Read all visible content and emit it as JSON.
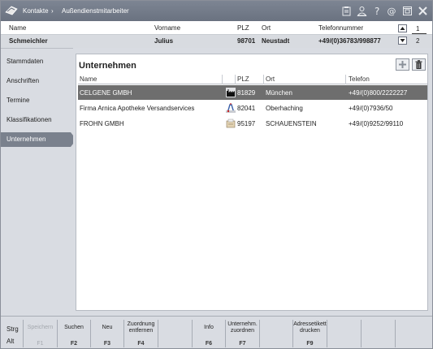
{
  "titlebar": {
    "crumb_root": "Kontakte",
    "separator": "›",
    "crumb_current": "Außendienstmitarbeiter"
  },
  "header": {
    "columns": [
      "Name",
      "Vorname",
      "PLZ",
      "Ort",
      "Telefonnummer"
    ],
    "record": {
      "name": "Schmeichler",
      "vorname": "Julius",
      "plz": "98701",
      "ort": "Neustadt",
      "telefon": "+49/(0)36783/998877"
    },
    "page_current": "1",
    "page_total": "2"
  },
  "nav": {
    "items": [
      {
        "label": "Stammdaten",
        "active": false
      },
      {
        "label": "Anschriften",
        "active": false
      },
      {
        "label": "Termine",
        "active": false
      },
      {
        "label": "Klassifikationen",
        "active": false
      },
      {
        "label": "Unternehmen",
        "active": true
      }
    ]
  },
  "panel": {
    "title": "Unternehmen",
    "columns": [
      "Name",
      "PLZ",
      "Ort",
      "Telefon"
    ],
    "rows": [
      {
        "name": "CELGENE GMBH",
        "icon": "factory-icon",
        "plz": "81829",
        "ort": "München",
        "telefon": "+49/(0)800/2222227",
        "selected": true
      },
      {
        "name": "Firma Arnica Apotheke Versandservices",
        "icon": "pharmacy-icon",
        "plz": "82041",
        "ort": "Oberhaching",
        "telefon": "+49/(0)7936/50",
        "selected": false
      },
      {
        "name": "FROHN GMBH",
        "icon": "wholesaler-icon",
        "plz": "95197",
        "ort": "SCHAUENSTEIN",
        "telefon": "+49/(0)9252/99110",
        "selected": false
      }
    ]
  },
  "fkeys": {
    "mod_strg": "Strg",
    "mod_alt": "Alt",
    "keys": [
      {
        "label": "Speichern",
        "code": "F1",
        "disabled": true
      },
      {
        "label": "Suchen",
        "code": "F2",
        "disabled": false
      },
      {
        "label": "Neu",
        "code": "F3",
        "disabled": false
      },
      {
        "label": "Zuordnung entfernen",
        "code": "F4",
        "disabled": false
      },
      {
        "label": "",
        "code": "",
        "disabled": false
      },
      {
        "label": "Info",
        "code": "F6",
        "disabled": false
      },
      {
        "label": "Unternehm. zuordnen",
        "code": "F7",
        "disabled": false
      },
      {
        "label": "",
        "code": "",
        "disabled": false
      },
      {
        "label": "Adressetikett drucken",
        "code": "F9",
        "disabled": false
      },
      {
        "label": "",
        "code": "",
        "disabled": false
      },
      {
        "label": "",
        "code": "",
        "disabled": false
      },
      {
        "label": "",
        "code": "",
        "disabled": false
      }
    ]
  },
  "colors": {
    "titlebar": "#737b89",
    "selection": "#6e6e6e",
    "nav_active": "#7a818d"
  }
}
